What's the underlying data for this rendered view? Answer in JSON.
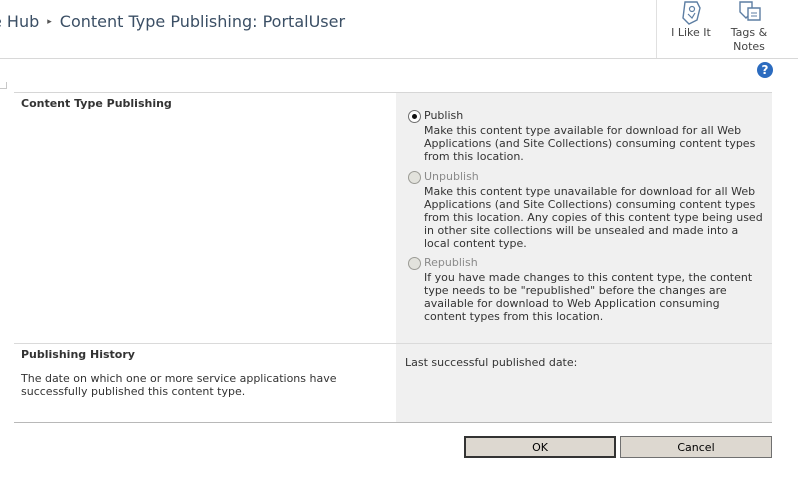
{
  "breadcrumb": {
    "parent": "e Hub",
    "separator": "▸",
    "current": "Content Type Publishing: PortalUser"
  },
  "social": {
    "like_label": "I Like It",
    "tags_label_line1": "Tags &",
    "tags_label_line2": "Notes"
  },
  "help": {
    "glyph": "?"
  },
  "publishing": {
    "title": "Content Type Publishing",
    "options": [
      {
        "label": "Publish",
        "checked": true,
        "enabled": true,
        "description": "Make this content type available for download for all Web Applications (and Site Collections) consuming content types from this location."
      },
      {
        "label": "Unpublish",
        "checked": false,
        "enabled": false,
        "description": "Make this content type unavailable for download for all Web Applications (and Site Collections) consuming content types from this location. Any copies of this content type being used in other site collections will be unsealed and made into a local content type."
      },
      {
        "label": "Republish",
        "checked": false,
        "enabled": false,
        "description": "If you have made changes to this content type, the content type needs to be \"republished\" before the changes are available for download to Web Application consuming content types from this location."
      }
    ]
  },
  "history": {
    "title": "Publishing History",
    "description": "The date on which one or more service applications have successfully published this content type.",
    "last_published_label": "Last successful published date:"
  },
  "buttons": {
    "ok": "OK",
    "cancel": "Cancel"
  },
  "colors": {
    "breadcrumb_text": "#3b4f65",
    "panel_background": "#f0f0f0",
    "help_icon": "#2b6bbf",
    "button_face": "#ddd8d0"
  }
}
